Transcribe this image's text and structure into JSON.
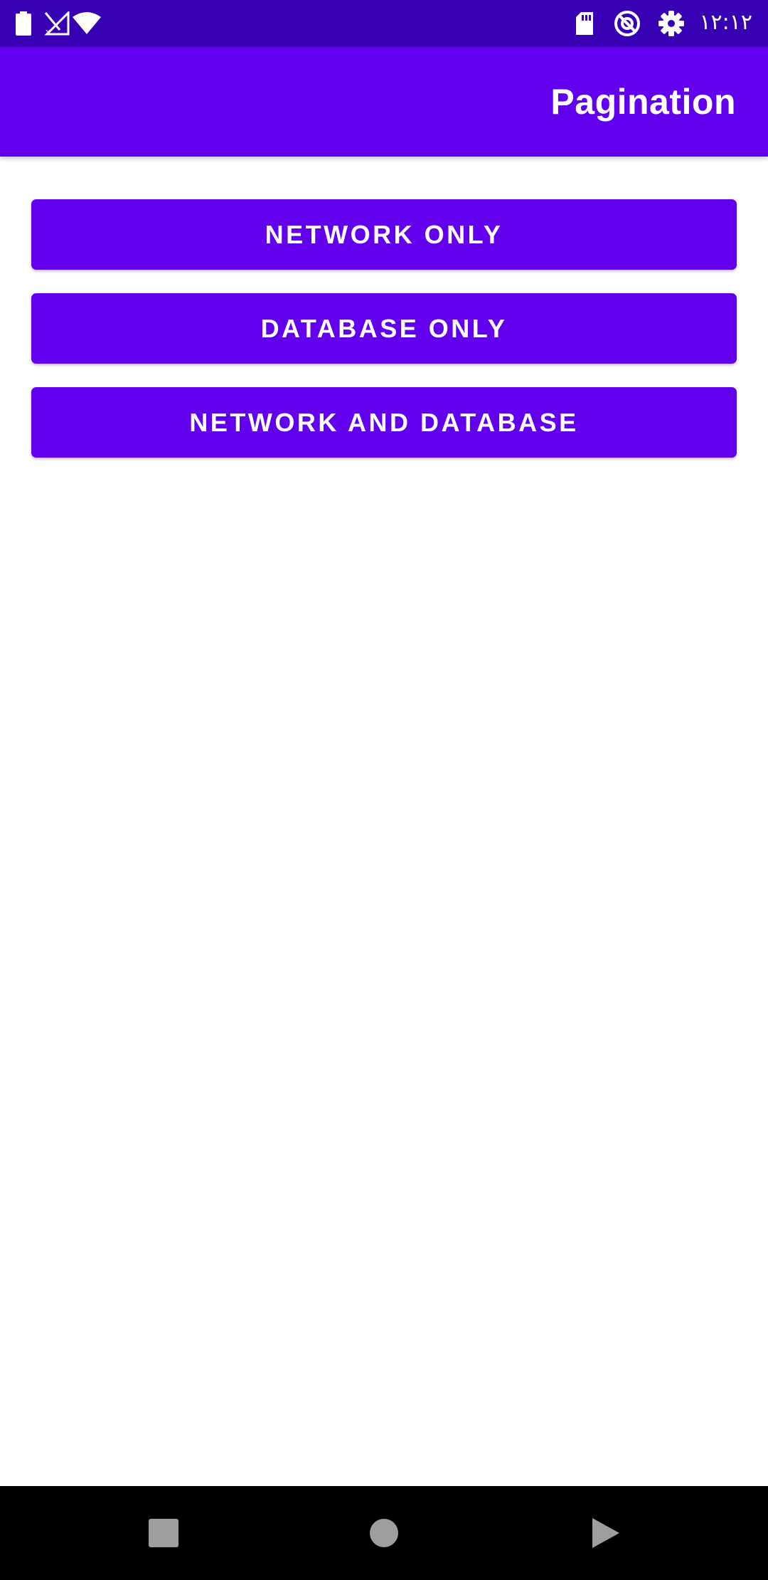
{
  "status_bar": {
    "time": "۱۲:۱۲",
    "icons": [
      "battery-icon",
      "no-signal-icon",
      "wifi-icon",
      "sd-card-icon",
      "vpn-icon",
      "settings-gear-icon"
    ]
  },
  "app_bar": {
    "title": "Pagination"
  },
  "buttons": {
    "network_only": "NETWORK ONLY",
    "database_only": "DATABASE ONLY",
    "network_and_database": "NETWORK AND DATABASE"
  },
  "nav_bar": {
    "icons": [
      "recents-square-icon",
      "home-circle-icon",
      "back-triangle-icon"
    ]
  },
  "colors": {
    "primary": "#6200ee",
    "primary_dark": "#3700b3",
    "background": "#ffffff",
    "nav_icon": "#9e9e9e"
  }
}
